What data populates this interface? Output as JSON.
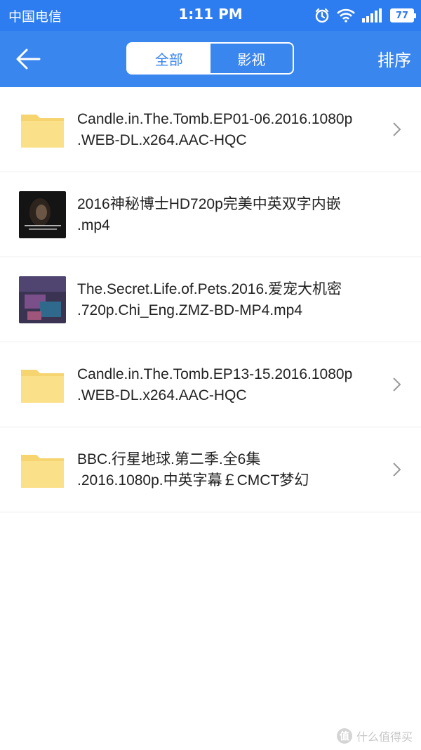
{
  "status_bar": {
    "carrier": "中国电信",
    "time": "1:11 PM",
    "battery": "77"
  },
  "header": {
    "tabs": [
      {
        "label": "全部",
        "active": true
      },
      {
        "label": "影视",
        "active": false
      }
    ],
    "sort_label": "排序"
  },
  "colors": {
    "accent": "#3a86ef",
    "folder": "#fbe08a"
  },
  "files": [
    {
      "type": "folder",
      "icon": "folder-icon",
      "line1": "Candle.in.The.Tomb.EP01-06.2016.1080p",
      "line2": ".WEB-DL.x264.AAC-HQC",
      "has_chevron": true
    },
    {
      "type": "video",
      "icon": "video-thumbnail",
      "line1": "2016神秘博士HD720p完美中英双字内嵌",
      "line2": ".mp4",
      "has_chevron": false
    },
    {
      "type": "video",
      "icon": "video-thumbnail",
      "line1": "The.Secret.Life.of.Pets.2016.爱宠大机密",
      "line2": ".720p.Chi_Eng.ZMZ-BD-MP4.mp4",
      "has_chevron": false
    },
    {
      "type": "folder",
      "icon": "folder-icon",
      "line1": "Candle.in.The.Tomb.EP13-15.2016.1080p",
      "line2": ".WEB-DL.x264.AAC-HQC",
      "has_chevron": true
    },
    {
      "type": "folder",
      "icon": "folder-icon",
      "line1": "BBC.行星地球.第二季.全6集",
      "line2": ".2016.1080p.中英字幕￡CMCT梦幻",
      "has_chevron": true
    }
  ],
  "watermark": {
    "badge": "值",
    "text": "什么值得买"
  }
}
